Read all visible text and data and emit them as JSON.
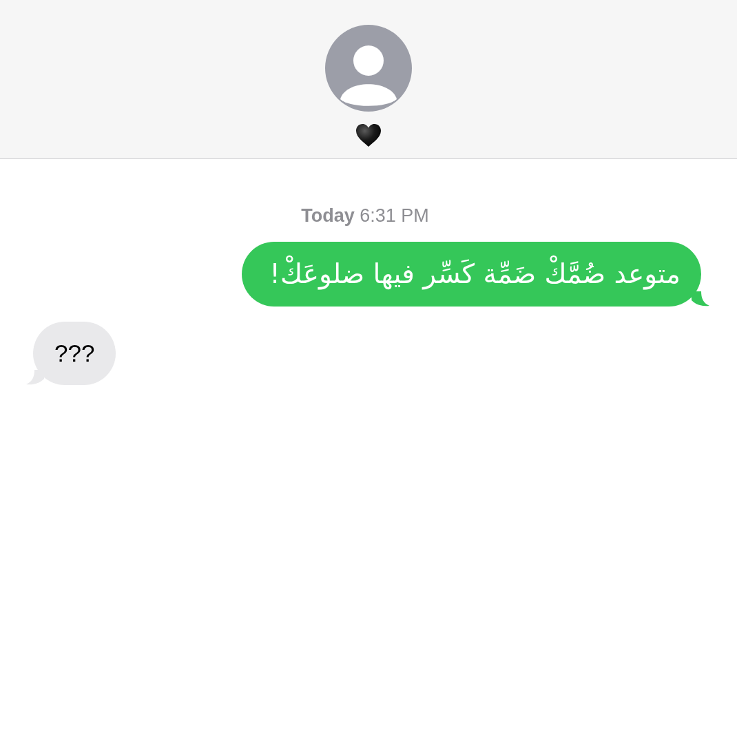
{
  "conversation": {
    "timestamp": "**Today** 6:31 PM",
    "messages": [
      {
        "kind": "sent",
        "text": "متوعد ضُمَّكْ ضَمِّة كَسِّر فيها ضلوعَكْ!"
      },
      {
        "kind": "received",
        "text": "???"
      }
    ]
  }
}
